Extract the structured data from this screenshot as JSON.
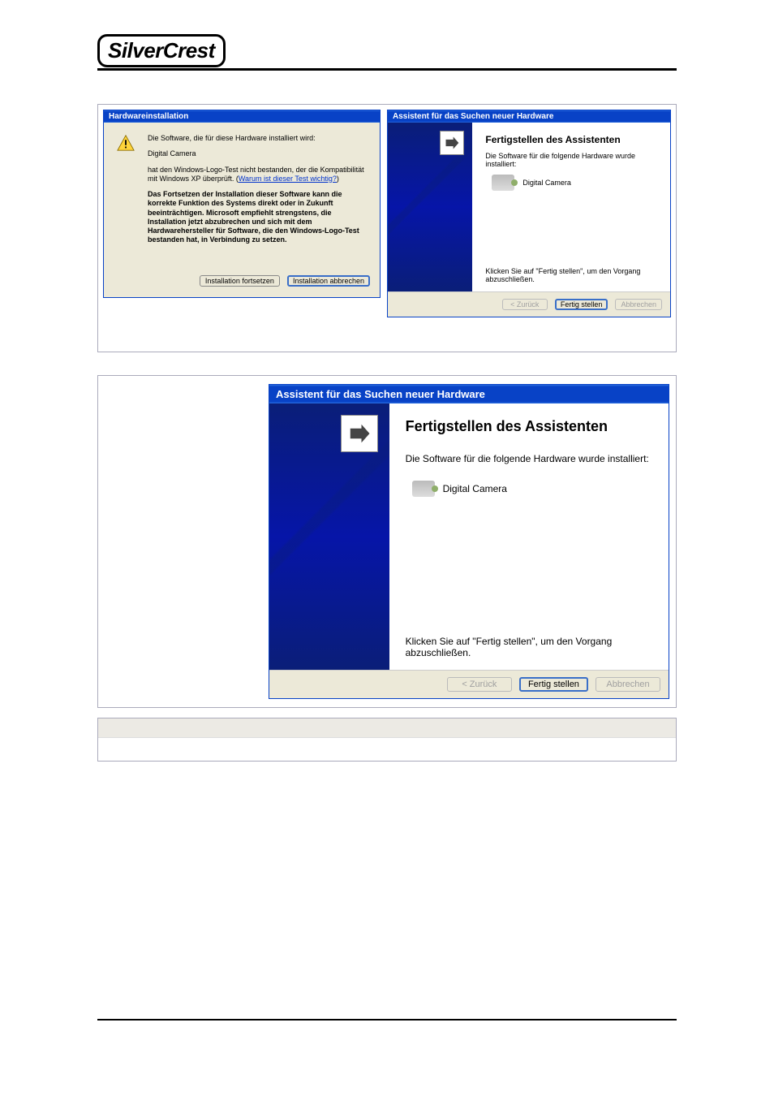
{
  "brand": {
    "name": "SilverCrest"
  },
  "dialog_install": {
    "title": "Hardwareinstallation",
    "line1": "Die Software, die für diese Hardware installiert wird:",
    "device": "Digital Camera",
    "line2a": "hat den Windows-Logo-Test nicht bestanden, der die Kompatibilität mit Windows XP überprüft. (",
    "link": "Warum ist dieser Test wichtig?",
    "line2b": ")",
    "warn": "Das Fortsetzen der Installation dieser Software kann die korrekte Funktion des Systems direkt oder in Zukunft beeinträchtigen. Microsoft empfiehlt strengstens, die Installation jetzt abzubrechen und sich mit dem Hardwarehersteller für Software, die den Windows-Logo-Test bestanden hat, in Verbindung zu setzen.",
    "btn_continue": "Installation fortsetzen",
    "btn_abort": "Installation abbrechen"
  },
  "dialog_done": {
    "title": "Assistent für das Suchen neuer Hardware",
    "heading": "Fertigstellen des Assistenten",
    "subtext": "Die Software für die folgende Hardware wurde installiert:",
    "device": "Digital Camera",
    "note": "Klicken Sie auf \"Fertig stellen\", um den Vorgang abzuschließen.",
    "btn_back": "< Zurück",
    "btn_finish": "Fertig stellen",
    "btn_cancel": "Abbrechen"
  }
}
